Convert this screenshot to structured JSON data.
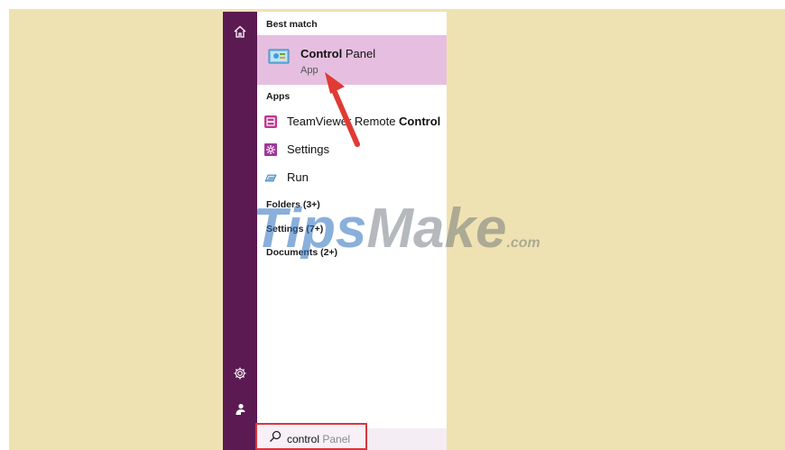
{
  "rail": {
    "home_icon": "home-icon",
    "settings_icon": "gear-icon",
    "user_icon": "user-icon"
  },
  "best_match": {
    "section_label": "Best match",
    "title_bold": "Control",
    "title_rest": " Panel",
    "subtitle": "App"
  },
  "apps": {
    "section_label": "Apps",
    "items": [
      {
        "label_pre": "TeamViewer Remote ",
        "label_bold": "Control",
        "icon": "teamviewer-icon"
      },
      {
        "label_pre": "Settings",
        "label_bold": "",
        "icon": "settings-app-icon"
      },
      {
        "label_pre": "Run",
        "label_bold": "",
        "icon": "run-icon"
      }
    ]
  },
  "categories": [
    "Folders (3+)",
    "Settings (7+)",
    "Documents (2+)"
  ],
  "search": {
    "typed": "control",
    "suggestion": " Panel"
  },
  "watermark": {
    "first": "Tips",
    "main": "Make",
    "tld": ".com"
  },
  "colors": {
    "background": "#efe2b2",
    "rail": "#5b1a52",
    "highlight": "#e6bfe0",
    "callout": "#d9363e"
  }
}
